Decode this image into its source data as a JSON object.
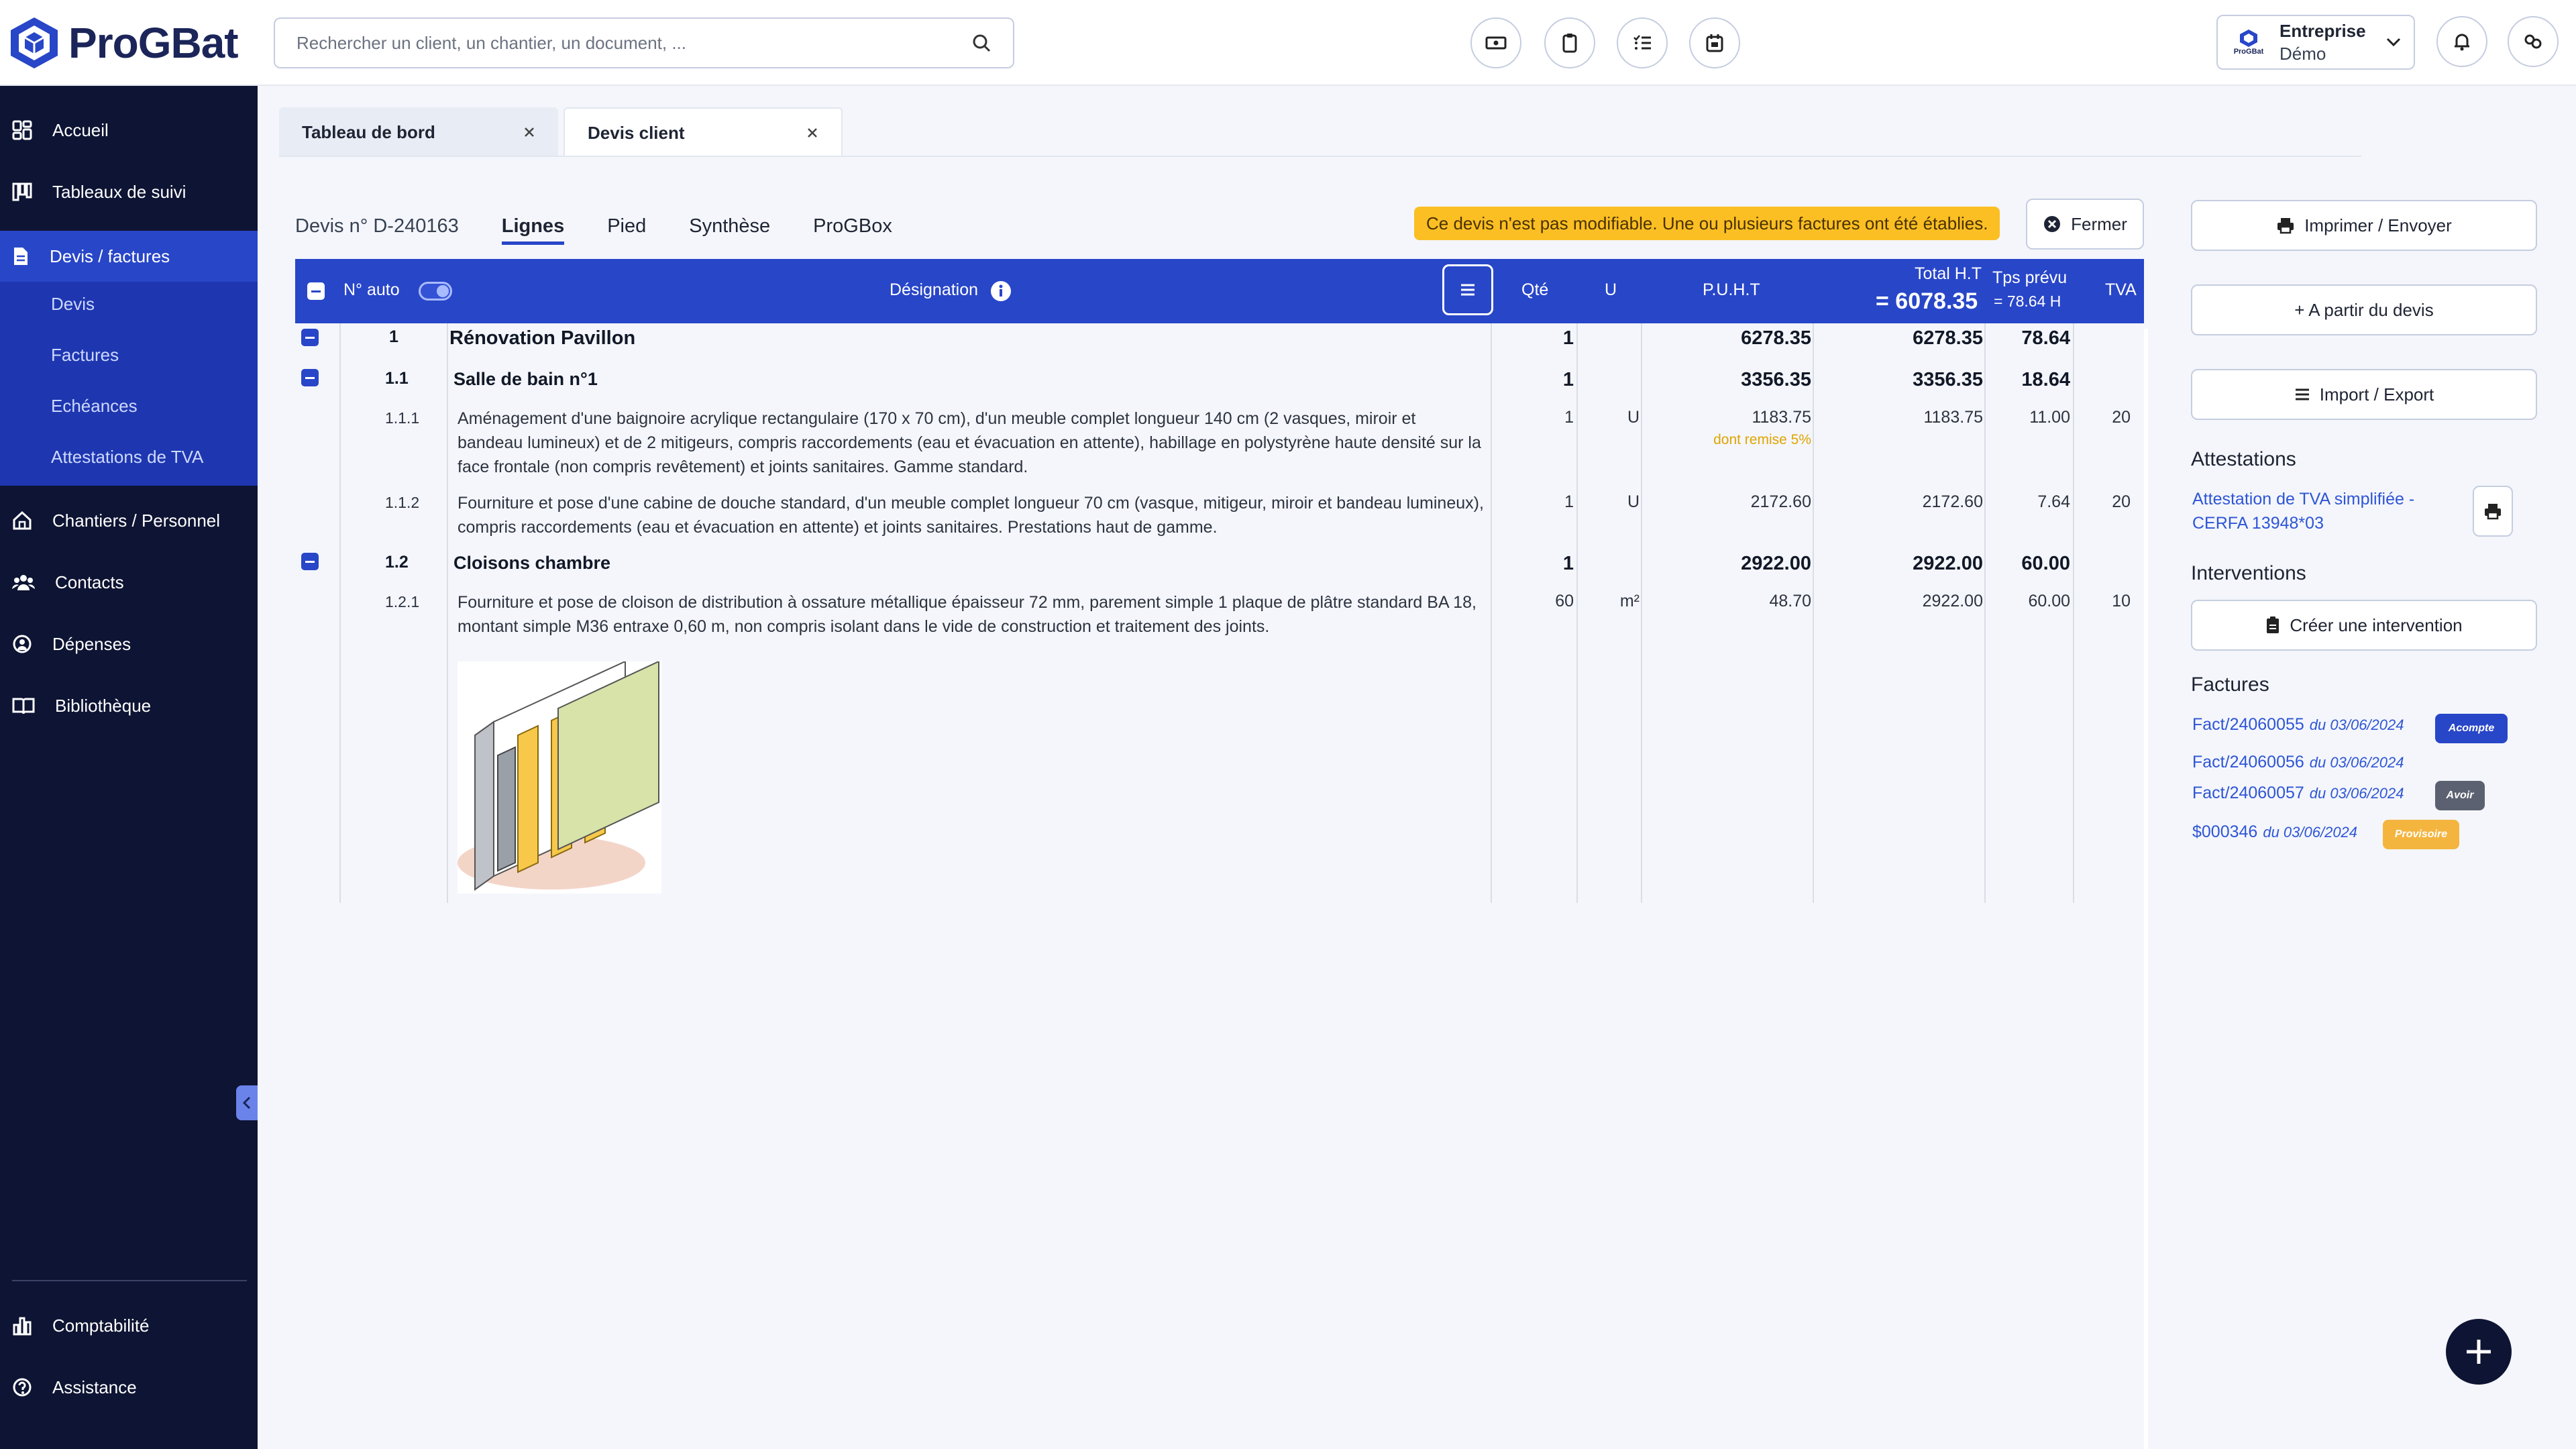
{
  "app": {
    "name": "ProGBat"
  },
  "header": {
    "search_placeholder": "Rechercher un client, un chantier, un document, ...",
    "company": {
      "name": "Entreprise",
      "sub": "Démo",
      "logo_caption": "ProGBat"
    }
  },
  "sidebar": {
    "items": [
      {
        "label": "Accueil",
        "icon": "dashboard-icon"
      },
      {
        "label": "Tableaux de suivi",
        "icon": "columns-icon"
      },
      {
        "label": "Devis / factures",
        "icon": "document-icon"
      },
      {
        "label": "Chantiers / Personnel",
        "icon": "house-icon"
      },
      {
        "label": "Contacts",
        "icon": "users-icon"
      },
      {
        "label": "Dépenses",
        "icon": "coin-icon"
      },
      {
        "label": "Bibliothèque",
        "icon": "book-icon"
      },
      {
        "label": "Comptabilité",
        "icon": "bar-chart-icon"
      },
      {
        "label": "Assistance",
        "icon": "help-icon"
      }
    ],
    "subitems": [
      "Devis",
      "Factures",
      "Echéances",
      "Attestations de TVA"
    ]
  },
  "tabs": [
    {
      "label": "Tableau de bord"
    },
    {
      "label": "Devis client"
    }
  ],
  "quote": {
    "number": "Devis n° D-240163",
    "subtabs": [
      "Lignes",
      "Pied",
      "Synthèse",
      "ProGBox"
    ],
    "warning": "Ce devis n'est pas modifiable. Une ou plusieurs factures ont été établies.",
    "close_label": "Fermer"
  },
  "table": {
    "headers": {
      "auto": "N° auto",
      "designation": "Désignation",
      "qty": "Qté",
      "unit": "U",
      "puht": "P.U.H.T",
      "total_label": "Total H.T",
      "total_value": "= 6078.35",
      "time_label": "Tps prévu",
      "time_value": "= 78.64 H",
      "tva": "TVA"
    },
    "rows": [
      {
        "num": "1",
        "designation": "Rénovation Pavillon",
        "qty": "1",
        "unit": "",
        "puht": "6278.35",
        "total": "6278.35",
        "time": "78.64",
        "tva": ""
      },
      {
        "num": "1.1",
        "designation": "Salle de bain n°1",
        "qty": "1",
        "unit": "",
        "puht": "3356.35",
        "total": "3356.35",
        "time": "18.64",
        "tva": ""
      },
      {
        "num": "1.1.1",
        "designation": "Aménagement d'une baignoire acrylique rectangulaire (170 x 70 cm), d'un meuble complet longueur 140 cm (2 vasques, miroir et bandeau lumineux) et de 2 mitigeurs, compris raccordements (eau et évacuation en attente), habillage en polystyrène haute densité sur la face frontale (non compris revêtement) et joints sanitaires. Gamme standard.",
        "qty": "1",
        "unit": "U",
        "puht": "1183.75",
        "discount": "dont remise 5%",
        "total": "1183.75",
        "time": "11.00",
        "tva": "20"
      },
      {
        "num": "1.1.2",
        "designation": "Fourniture et pose d'une cabine de douche standard, d'un meuble complet longueur 70 cm (vasque, mitigeur, miroir et bandeau lumineux), compris raccordements (eau et évacuation en attente) et joints sanitaires. Prestations haut de gamme.",
        "qty": "1",
        "unit": "U",
        "puht": "2172.60",
        "total": "2172.60",
        "time": "7.64",
        "tva": "20"
      },
      {
        "num": "1.2",
        "designation": "Cloisons chambre",
        "qty": "1",
        "unit": "",
        "puht": "2922.00",
        "total": "2922.00",
        "time": "60.00",
        "tva": ""
      },
      {
        "num": "1.2.1",
        "designation": "Fourniture et pose de cloison de distribution à ossature métallique épaisseur 72 mm, parement simple 1 plaque de plâtre standard BA 18, montant simple M36 entraxe 0,60 m, non compris isolant dans le vide de construction et traitement des joints.",
        "qty": "60",
        "unit": "m²",
        "puht": "48.70",
        "total": "2922.00",
        "time": "60.00",
        "tva": "10"
      }
    ]
  },
  "right_panel": {
    "print_label": "Imprimer / Envoyer",
    "from_quote_label": "+ A partir du devis",
    "import_export_label": "Import / Export",
    "attestations_title": "Attestations",
    "attestation_link": "Attestation de TVA simplifiée - CERFA 13948*03",
    "interventions_title": "Interventions",
    "create_intervention_label": "Créer une intervention",
    "invoices_title": "Factures",
    "invoices": [
      {
        "ref": "Fact/24060055",
        "date": "du 03/06/2024",
        "badge": "Acompte",
        "badge_color": "#2846c8"
      },
      {
        "ref": "Fact/24060056",
        "date": "du 03/06/2024",
        "badge": "",
        "badge_color": ""
      },
      {
        "ref": "Fact/24060057",
        "date": "du 03/06/2024",
        "badge": "Avoir",
        "badge_color": "#5b6170"
      },
      {
        "ref": "$000346",
        "date": "du 03/06/2024",
        "badge": "Provisoire",
        "badge_color": "#f4b53f"
      }
    ]
  },
  "colors": {
    "brand": "#2846c8",
    "sidebar": "#0e1433",
    "warning": "#fbbf24",
    "discount": "#e0a400"
  }
}
